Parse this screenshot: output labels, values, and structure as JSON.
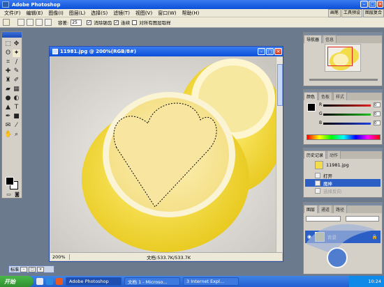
{
  "app": {
    "title": "Adobe Photoshop"
  },
  "menu": [
    "文件(F)",
    "编辑(E)",
    "图像(I)",
    "图层(L)",
    "选择(S)",
    "滤镜(T)",
    "视图(V)",
    "窗口(W)",
    "帮助(H)"
  ],
  "palette_well": [
    "画笔",
    "工具预设",
    "图层复合"
  ],
  "options": {
    "tolerance_label": "容差:",
    "tolerance_value": "25",
    "antialias_label": "消除锯齿",
    "contiguous_label": "连续",
    "all_layers_label": "对所有图层取样"
  },
  "document": {
    "title": "11981.jpg @ 200%(RGB/8#)",
    "zoom": "200%",
    "doc_info": "文档:533.7K/533.7K"
  },
  "navigator": {
    "tabs": [
      "导航器",
      "信息"
    ]
  },
  "color_panel": {
    "tabs": [
      "颜色",
      "色板",
      "样式"
    ],
    "channels": [
      {
        "label": "R",
        "value": "0",
        "color": "#e02020"
      },
      {
        "label": "G",
        "value": "0",
        "color": "#20c020"
      },
      {
        "label": "B",
        "value": "0",
        "color": "#2040e0"
      }
    ]
  },
  "history_panel": {
    "tabs": [
      "历史记录",
      "动作"
    ],
    "snapshot": "11981.jpg",
    "items": [
      {
        "label": "打开",
        "state": "normal"
      },
      {
        "label": "魔棒",
        "state": "selected"
      },
      {
        "label": "选择反向",
        "state": "dim"
      }
    ]
  },
  "layers_panel": {
    "tabs": [
      "图层",
      "通道",
      "路径"
    ],
    "layer_name": "背景"
  },
  "minimized_window": {
    "label": "标准"
  },
  "taskbar": {
    "start": "开始",
    "tasks": [
      "Adobe Photoshop",
      "文档 1 - Microso...",
      "3 Internet Expl..."
    ],
    "clock": "10:24"
  },
  "colors": {
    "accent": "#0a4fd8",
    "lemon": "#f3dc4a",
    "selection_highlight": "#2c5fc6"
  }
}
